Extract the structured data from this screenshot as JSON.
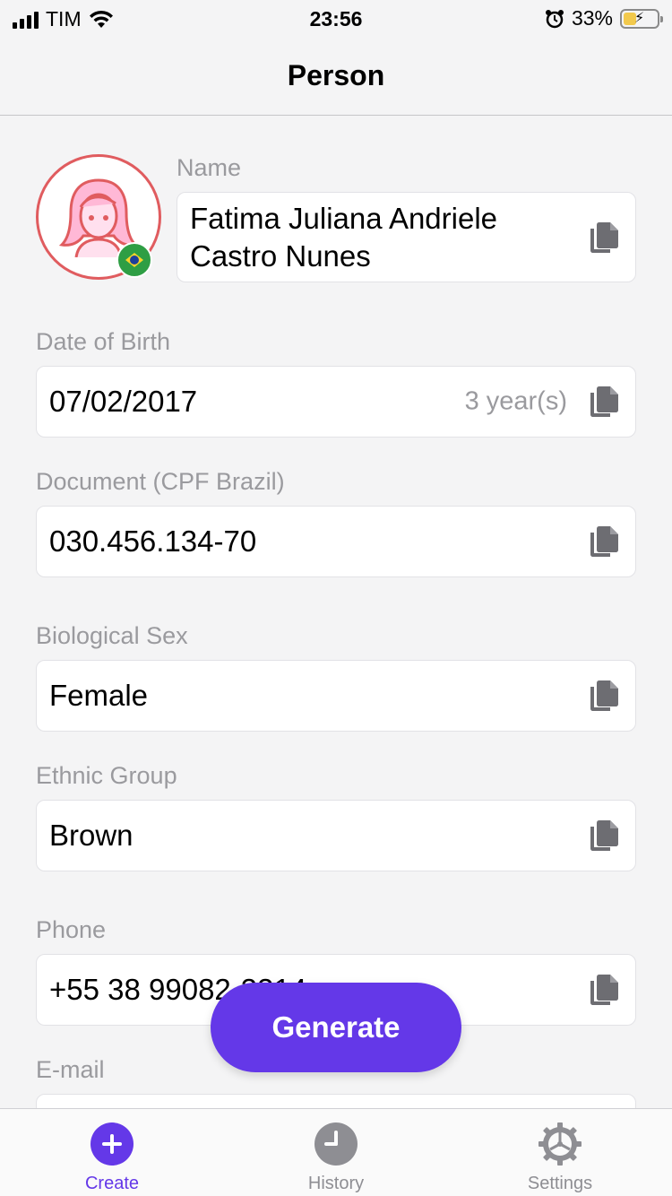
{
  "status_bar": {
    "carrier": "TIM",
    "time": "23:56",
    "battery": "33%",
    "icons": [
      "signal-icon",
      "wifi-icon",
      "alarm-icon",
      "battery-charging-icon"
    ]
  },
  "nav": {
    "title": "Person"
  },
  "person": {
    "avatar_icon": "female-avatar-icon",
    "flag_icon": "brazil-flag-icon",
    "name_label": "Name",
    "name_value": "Fatima Juliana Andriele Castro Nunes",
    "dob_label": "Date of Birth",
    "dob_value": "07/02/2017",
    "dob_age": "3 year(s)",
    "doc_label": "Document (CPF Brazil)",
    "doc_value": "030.456.134-70",
    "sex_label": "Biological Sex",
    "sex_value": "Female",
    "ethnic_label": "Ethnic Group",
    "ethnic_value": "Brown",
    "phone_label": "Phone",
    "phone_value": "+55 38 99082-3314",
    "email_label": "E-mail",
    "email_value": ""
  },
  "actions": {
    "generate_label": "Generate"
  },
  "tabs": [
    {
      "label": "Create",
      "icon": "plus-circle-icon",
      "active": true
    },
    {
      "label": "History",
      "icon": "clock-icon",
      "active": false
    },
    {
      "label": "Settings",
      "icon": "gear-icon",
      "active": false
    }
  ],
  "colors": {
    "accent": "#6438e8",
    "avatar_ring": "#e05c5f"
  }
}
